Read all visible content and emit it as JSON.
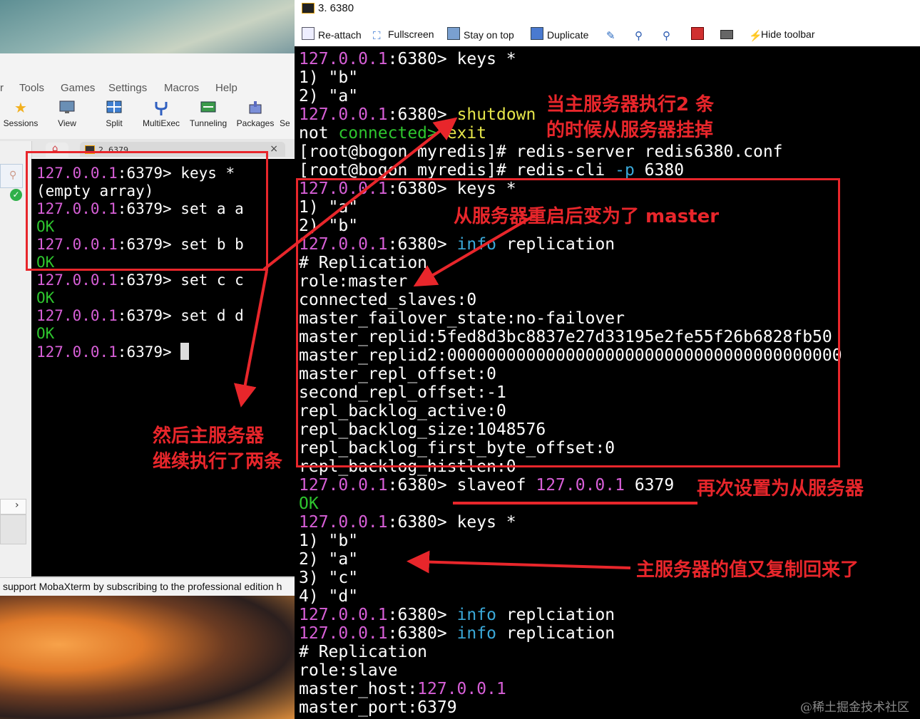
{
  "mobaxterm": {
    "menu": [
      "r",
      "Tools",
      "Games",
      "Settings",
      "Macros",
      "Help"
    ],
    "toolbar": [
      {
        "label": "Sessions",
        "icon": "star-icon"
      },
      {
        "label": "View",
        "icon": "monitor-icon"
      },
      {
        "label": "Split",
        "icon": "split-icon"
      },
      {
        "label": "MultiExec",
        "icon": "fork-icon"
      },
      {
        "label": "Tunneling",
        "icon": "tunnel-icon"
      },
      {
        "label": "Packages",
        "icon": "package-icon"
      },
      {
        "label": "Se",
        "icon": ""
      }
    ],
    "tab_title": "2. 6379",
    "status_text": "support MobaXterm by subscribing to the professional edition h"
  },
  "left_terminal": {
    "lines": [
      {
        "prompt": "127.0.0.1",
        "port": ":6379>",
        "cmd": " keys *"
      },
      {
        "text": "(empty array)"
      },
      {
        "prompt": "127.0.0.1",
        "port": ":6379>",
        "cmd": " set a a"
      },
      {
        "ok": "OK"
      },
      {
        "prompt": "127.0.0.1",
        "port": ":6379>",
        "cmd": " set b b"
      },
      {
        "ok": "OK"
      },
      {
        "prompt": "127.0.0.1",
        "port": ":6379>",
        "cmd": " set c c"
      },
      {
        "ok": "OK"
      },
      {
        "prompt": "127.0.0.1",
        "port": ":6379>",
        "cmd": " set d d"
      },
      {
        "ok": "OK"
      },
      {
        "prompt": "127.0.0.1",
        "port": ":6379>",
        "cmd": " "
      }
    ]
  },
  "right_window": {
    "title": "3. 6380",
    "toolbar": {
      "reattach": "Re-attach",
      "fullscreen": "Fullscreen",
      "stay_on_top": "Stay on top",
      "duplicate": "Duplicate",
      "hide_toolbar": "Hide toolbar"
    }
  },
  "right_terminal": {
    "l1": {
      "prompt": "127.0.0.1",
      "port": ":6380>",
      "cmd": " keys *"
    },
    "l2": "1) \"b\"",
    "l3": "2) \"a\"",
    "l4": {
      "prompt": "127.0.0.1",
      "port": ":6380>",
      "sp": " ",
      "cmd": "shutdown"
    },
    "l5": {
      "a": "not ",
      "b": "connected>",
      "c": " exit"
    },
    "l6": "[root@bogon myredis]# redis-server redis6380.conf",
    "l7": {
      "a": "[root@bogon myredis]# redis-cli ",
      "b": "-p",
      "c": " 6380"
    },
    "l8": {
      "prompt": "127.0.0.1",
      "port": ":6380>",
      "cmd": " keys *"
    },
    "l9": "1) \"a\"",
    "l10": "2) \"b\"",
    "l11": {
      "prompt": "127.0.0.1",
      "port": ":6380>",
      "sp": " ",
      "kw": "info",
      "cmd": " replication"
    },
    "l12": "# Replication",
    "l13": "role:master",
    "l14": "connected_slaves:0",
    "l15": "master_failover_state:no-failover",
    "l16": "master_replid:5fed8d3bc8837e27d33195e2fe55f26b6828fb50",
    "l17": "master_replid2:0000000000000000000000000000000000000000",
    "l18": "master_repl_offset:0",
    "l19": "second_repl_offset:-1",
    "l20": "repl_backlog_active:0",
    "l21": "repl_backlog_size:1048576",
    "l22": "repl_backlog_first_byte_offset:0",
    "l23": "repl_backlog_histlen:0",
    "l24": {
      "prompt": "127.0.0.1",
      "port": ":6380>",
      "cmd": " slaveof ",
      "ip": "127.0.0.1",
      "rest": " 6379"
    },
    "l25": "OK",
    "l26": {
      "prompt": "127.0.0.1",
      "port": ":6380>",
      "cmd": " keys *"
    },
    "l27": "1) \"b\"",
    "l28": "2) \"a\"",
    "l29": "3) \"c\"",
    "l30": "4) \"d\"",
    "l31": {
      "prompt": "127.0.0.1",
      "port": ":6380>",
      "sp": " ",
      "kw": "info",
      "cmd": " replciation"
    },
    "l32": {
      "prompt": "127.0.0.1",
      "port": ":6380>",
      "sp": " ",
      "kw": "info",
      "cmd": " replication"
    },
    "l33": "# Replication",
    "l34": "role:slave",
    "l35": {
      "a": "master_host:",
      "b": "127.0.0.1"
    },
    "l36": "master_port:6379"
  },
  "annotations": {
    "n1_line1": "当主服务器执行2 条",
    "n1_line2": "的时候从服务器挂掉",
    "n2": "从服务器重启后变为了 master",
    "n3_line1": "然后主服务器",
    "n3_line2": "继续执行了两条",
    "n4": "再次设置为从服务器",
    "n5": "主服务器的值又复制回来了"
  },
  "watermark": "@稀土掘金技术社区"
}
